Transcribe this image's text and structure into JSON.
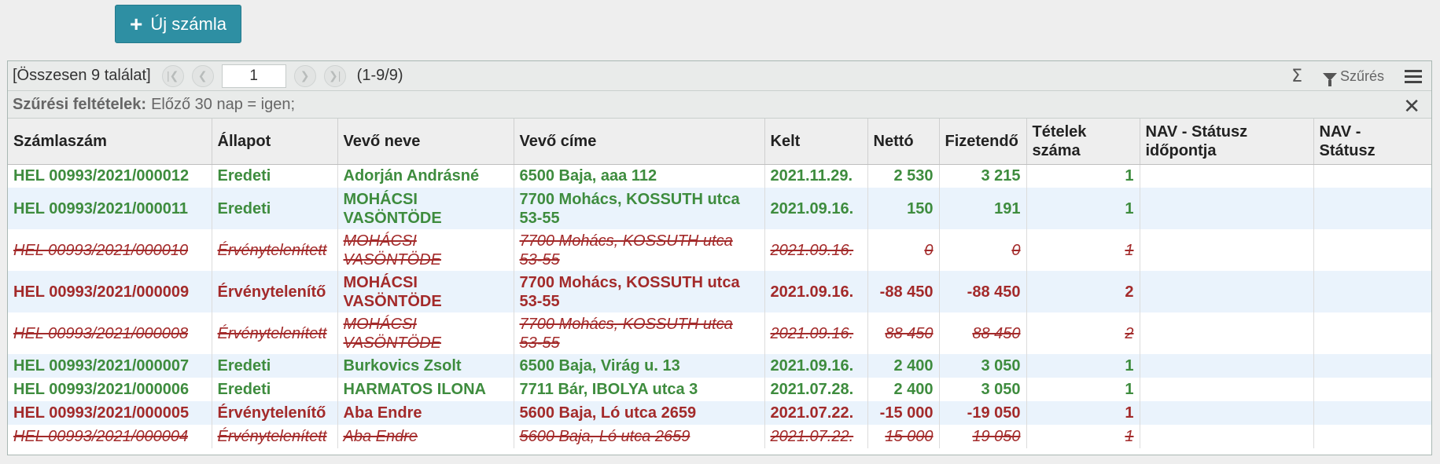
{
  "toolbar": {
    "new_invoice_label": "Új számla",
    "new_invoice_icon": "plus-icon"
  },
  "pager": {
    "total_text": "[Összesen 9 találat]",
    "page_value": "1",
    "range_text": "(1-9/9)",
    "sum_icon": "Σ",
    "filter_label": "Szűrés"
  },
  "filter": {
    "label": "Szűrési feltételek:",
    "value": "Előző 30 nap = igen;"
  },
  "columns": [
    {
      "line1": "Számlaszám",
      "line2": ""
    },
    {
      "line1": "Állapot",
      "line2": ""
    },
    {
      "line1": "Vevő neve",
      "line2": ""
    },
    {
      "line1": "Vevő címe",
      "line2": ""
    },
    {
      "line1": "Kelt",
      "line2": ""
    },
    {
      "line1": "Nettó",
      "line2": ""
    },
    {
      "line1": "Fizetendő",
      "line2": ""
    },
    {
      "line1": "Tételek",
      "line2": "száma"
    },
    {
      "line1": "NAV - Státusz",
      "line2": "időpontja"
    },
    {
      "line1": "NAV -",
      "line2": "Státusz"
    }
  ],
  "rows": [
    {
      "cells": [
        "HEL 00993/2021/000012",
        "Eredeti",
        "Adorján Andrásné",
        "6500 Baja, aaa 112",
        "2021.11.29.",
        "2 530",
        "3 215",
        "1",
        "",
        ""
      ],
      "status": "green"
    },
    {
      "cells": [
        "HEL 00993/2021/000011",
        "Eredeti",
        "MOHÁCSI VASÖNTÖDE",
        "7700 Mohács, KOSSUTH utca 53-55",
        "2021.09.16.",
        "150",
        "191",
        "1",
        "",
        ""
      ],
      "status": "green"
    },
    {
      "cells": [
        "HEL 00993/2021/000010",
        "Érvénytelenített",
        "MOHÁCSI VASÖNTÖDE",
        "7700 Mohács, KOSSUTH utca 53-55",
        "2021.09.16.",
        "0",
        "0",
        "1",
        "",
        ""
      ],
      "status": "cancel"
    },
    {
      "cells": [
        "HEL 00993/2021/000009",
        "Érvénytelenítő",
        "MOHÁCSI VASÖNTÖDE",
        "7700 Mohács, KOSSUTH utca 53-55",
        "2021.09.16.",
        "-88 450",
        "-88 450",
        "2",
        "",
        ""
      ],
      "status": "red"
    },
    {
      "cells": [
        "HEL 00993/2021/000008",
        "Érvénytelenített",
        "MOHÁCSI VASÖNTÖDE",
        "7700 Mohács, KOSSUTH utca 53-55",
        "2021.09.16.",
        "88 450",
        "88 450",
        "2",
        "",
        ""
      ],
      "status": "cancel"
    },
    {
      "cells": [
        "HEL 00993/2021/000007",
        "Eredeti",
        "Burkovics Zsolt",
        "6500 Baja, Virág u. 13",
        "2021.09.16.",
        "2 400",
        "3 050",
        "1",
        "",
        ""
      ],
      "status": "green"
    },
    {
      "cells": [
        "HEL 00993/2021/000006",
        "Eredeti",
        "HARMATOS ILONA",
        "7711 Bár, IBOLYA utca 3",
        "2021.07.28.",
        "2 400",
        "3 050",
        "1",
        "",
        ""
      ],
      "status": "green"
    },
    {
      "cells": [
        "HEL 00993/2021/000005",
        "Érvénytelenítő",
        "Aba Endre",
        "5600 Baja, Ló utca 2659",
        "2021.07.22.",
        "-15 000",
        "-19 050",
        "1",
        "",
        ""
      ],
      "status": "red"
    },
    {
      "cells": [
        "HEL 00993/2021/000004",
        "Érvénytelenített",
        "Aba Endre",
        "5600 Baja, Ló utca 2659",
        "2021.07.22.",
        "15 000",
        "19 050",
        "1",
        "",
        ""
      ],
      "status": "cancel"
    }
  ],
  "colors": {
    "green": "#3e8c3e",
    "red": "#a32a2a",
    "accent": "#2e8fa3",
    "row_alt": "#eaf3fc"
  }
}
